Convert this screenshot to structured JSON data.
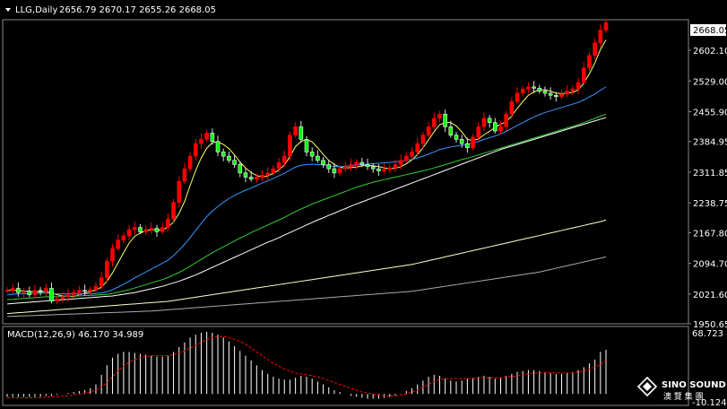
{
  "header": {
    "symbol_label": "LLG,Daily",
    "ohlc": "2656.79 2670.17 2655.26 2668.05"
  },
  "macd_header": "MACD(12,26,9) 46.170 34.989",
  "price_axis": {
    "ticks": [
      "2602.10",
      "2529.00",
      "2455.90",
      "2384.95",
      "2311.85",
      "2238.75",
      "2167.80",
      "2094.70",
      "2021.60",
      "1950.65"
    ],
    "current_label": "2668.05"
  },
  "macd_axis": {
    "top_label": "68.723",
    "bottom_label": "-10.124"
  },
  "watermark": {
    "brand": "SINO SOUND",
    "cjk": "澳 覽 集 團"
  },
  "colors": {
    "background": "#000000",
    "bull_candle": "#ffffff",
    "bear_candle": "#ff0000",
    "up_candle_fill": "#00ff00",
    "ma5": "#ffff66",
    "ma20": "#3399ff",
    "ma40": "#33cc33",
    "ma60": "#ffffff",
    "ma120": "#ffffcc",
    "ma250": "#aaaaaa",
    "macd_hist": "#ffffff",
    "macd_signal": "#ff0000"
  },
  "chart_data": {
    "type": "candlestick",
    "title": "LLG,Daily",
    "ylim": [
      1950.65,
      2675
    ],
    "y_ticks": [
      1950.65,
      2021.6,
      2094.7,
      2167.8,
      2238.75,
      2311.85,
      2384.95,
      2455.9,
      2529.0,
      2602.1
    ],
    "current_close": 2668.05,
    "closes": [
      2030,
      2035,
      2025,
      2028,
      2020,
      2030,
      2028,
      2035,
      2005,
      2010,
      2015,
      2020,
      2025,
      2030,
      2028,
      2032,
      2040,
      2060,
      2100,
      2130,
      2150,
      2160,
      2175,
      2180,
      2170,
      2175,
      2178,
      2170,
      2180,
      2200,
      2240,
      2290,
      2320,
      2350,
      2380,
      2390,
      2405,
      2385,
      2360,
      2350,
      2340,
      2330,
      2310,
      2300,
      2295,
      2300,
      2305,
      2310,
      2320,
      2335,
      2350,
      2400,
      2420,
      2390,
      2360,
      2350,
      2340,
      2330,
      2320,
      2310,
      2320,
      2325,
      2330,
      2335,
      2330,
      2325,
      2320,
      2315,
      2318,
      2322,
      2330,
      2340,
      2350,
      2360,
      2380,
      2400,
      2420,
      2440,
      2450,
      2420,
      2400,
      2390,
      2380,
      2370,
      2395,
      2420,
      2440,
      2430,
      2410,
      2420,
      2450,
      2480,
      2500,
      2510,
      2515,
      2512,
      2505,
      2500,
      2495,
      2492,
      2498,
      2505,
      2510,
      2525,
      2560,
      2590,
      2620,
      2650,
      2668.05
    ],
    "series": [
      {
        "name": "MA5",
        "values": [
          2030,
          2031,
          2030,
          2029,
          2028,
          2027,
          2026,
          2028,
          2024,
          2020,
          2017,
          2016,
          2015,
          2020,
          2024,
          2027,
          2031,
          2038,
          2052,
          2072,
          2096,
          2120,
          2143,
          2159,
          2167,
          2172,
          2175,
          2174,
          2174,
          2181,
          2193,
          2214,
          2242,
          2280,
          2316,
          2346,
          2369,
          2382,
          2384,
          2378,
          2368,
          2353,
          2336,
          2322,
          2311,
          2304,
          2300,
          2303,
          2309,
          2317,
          2329,
          2349,
          2373,
          2385,
          2390,
          2384,
          2370,
          2354,
          2340,
          2330,
          2324,
          2321,
          2323,
          2324,
          2327,
          2328,
          2327,
          2325,
          2322,
          2320,
          2321,
          2325,
          2332,
          2341,
          2354,
          2370,
          2389,
          2408,
          2425,
          2430,
          2430,
          2422,
          2408,
          2390,
          2387,
          2391,
          2401,
          2409,
          2419,
          2426,
          2432,
          2446,
          2464,
          2480,
          2495,
          2503,
          2508,
          2508,
          2505,
          2500,
          2499,
          2500,
          2502,
          2508,
          2524,
          2546,
          2572,
          2604,
          2627
        ]
      },
      {
        "name": "MA20",
        "values": [
          2020,
          2021,
          2022,
          2022,
          2023,
          2023,
          2023,
          2024,
          2023,
          2022,
          2022,
          2022,
          2022,
          2022,
          2022,
          2022,
          2023,
          2024,
          2027,
          2032,
          2038,
          2045,
          2052,
          2060,
          2067,
          2074,
          2081,
          2088,
          2095,
          2102,
          2113,
          2126,
          2140,
          2156,
          2173,
          2190,
          2206,
          2219,
          2230,
          2240,
          2249,
          2256,
          2263,
          2269,
          2274,
          2280,
          2286,
          2291,
          2297,
          2303,
          2309,
          2317,
          2324,
          2328,
          2330,
          2331,
          2330,
          2329,
          2327,
          2325,
          2325,
          2326,
          2327,
          2329,
          2330,
          2331,
          2332,
          2333,
          2334,
          2335,
          2336,
          2338,
          2340,
          2342,
          2346,
          2350,
          2355,
          2360,
          2366,
          2369,
          2372,
          2374,
          2376,
          2378,
          2381,
          2385,
          2390,
          2394,
          2398,
          2403,
          2409,
          2416,
          2423,
          2430,
          2437,
          2443,
          2449,
          2454,
          2458,
          2462,
          2466,
          2470,
          2474,
          2478,
          2484,
          2491,
          2498,
          2507,
          2515
        ]
      },
      {
        "name": "MA40",
        "values": [
          2008,
          2009,
          2010,
          2011,
          2012,
          2013,
          2014,
          2015,
          2015,
          2015,
          2016,
          2016,
          2017,
          2017,
          2018,
          2018,
          2019,
          2020,
          2021,
          2023,
          2026,
          2029,
          2032,
          2036,
          2040,
          2044,
          2048,
          2052,
          2056,
          2061,
          2067,
          2073,
          2080,
          2088,
          2096,
          2104,
          2112,
          2120,
          2127,
          2134,
          2141,
          2148,
          2155,
          2161,
          2168,
          2174,
          2180,
          2186,
          2192,
          2198,
          2204,
          2211,
          2218,
          2224,
          2230,
          2236,
          2241,
          2246,
          2251,
          2256,
          2261,
          2266,
          2271,
          2276,
          2280,
          2284,
          2288,
          2291,
          2294,
          2297,
          2300,
          2303,
          2306,
          2309,
          2312,
          2315,
          2318,
          2322,
          2326,
          2330,
          2334,
          2338,
          2342,
          2345,
          2349,
          2353,
          2357,
          2361,
          2365,
          2369,
          2373,
          2377,
          2381,
          2385,
          2389,
          2393,
          2397,
          2401,
          2405,
          2409,
          2413,
          2417,
          2421,
          2425,
          2430,
          2435,
          2440,
          2445,
          2450
        ]
      },
      {
        "name": "MA60",
        "values": [
          1998,
          1999,
          2000,
          2001,
          2002,
          2003,
          2004,
          2005,
          2006,
          2007,
          2008,
          2009,
          2010,
          2011,
          2012,
          2013,
          2014,
          2015,
          2016,
          2017,
          2019,
          2021,
          2023,
          2025,
          2028,
          2031,
          2034,
          2037,
          2040,
          2044,
          2048,
          2052,
          2057,
          2062,
          2067,
          2073,
          2079,
          2085,
          2091,
          2097,
          2103,
          2109,
          2115,
          2121,
          2127,
          2133,
          2139,
          2145,
          2150,
          2156,
          2162,
          2168,
          2174,
          2180,
          2186,
          2192,
          2198,
          2203,
          2209,
          2214,
          2220,
          2225,
          2231,
          2236,
          2241,
          2246,
          2251,
          2256,
          2261,
          2266,
          2271,
          2276,
          2281,
          2286,
          2291,
          2296,
          2301,
          2306,
          2311,
          2316,
          2321,
          2326,
          2331,
          2336,
          2341,
          2346,
          2351,
          2356,
          2361,
          2366,
          2370,
          2374,
          2378,
          2382,
          2386,
          2390,
          2394,
          2398,
          2402,
          2406,
          2410,
          2414,
          2418,
          2422,
          2426,
          2430,
          2434,
          2438,
          2442
        ]
      },
      {
        "name": "MA120",
        "values": [
          1975,
          1976,
          1977,
          1978,
          1979,
          1980,
          1981,
          1982,
          1983,
          1984,
          1985,
          1986,
          1987,
          1988,
          1989,
          1990,
          1991,
          1992,
          1993,
          1994,
          1995,
          1996,
          1997,
          1998,
          1999,
          2000,
          2001,
          2002,
          2003,
          2004,
          2006,
          2008,
          2010,
          2012,
          2014,
          2016,
          2018,
          2020,
          2022,
          2024,
          2026,
          2028,
          2030,
          2032,
          2034,
          2036,
          2038,
          2040,
          2042,
          2044,
          2046,
          2048,
          2050,
          2052,
          2054,
          2056,
          2058,
          2060,
          2062,
          2064,
          2066,
          2068,
          2070,
          2072,
          2074,
          2076,
          2078,
          2080,
          2082,
          2084,
          2086,
          2088,
          2090,
          2092,
          2095,
          2098,
          2101,
          2104,
          2107,
          2110,
          2113,
          2116,
          2119,
          2122,
          2125,
          2128,
          2131,
          2134,
          2137,
          2140,
          2143,
          2146,
          2149,
          2152,
          2155,
          2158,
          2161,
          2164,
          2167,
          2170,
          2173,
          2176,
          2179,
          2182,
          2185,
          2188,
          2191,
          2194,
          2198
        ]
      },
      {
        "name": "MA250",
        "values": [
          1968,
          1968.5,
          1969,
          1969.5,
          1970,
          1970.5,
          1971,
          1971.5,
          1972,
          1972.5,
          1973,
          1973.5,
          1974,
          1974.5,
          1975,
          1975.5,
          1976,
          1976.5,
          1977,
          1977.5,
          1978,
          1978.5,
          1979,
          1979.5,
          1980,
          1980.5,
          1981,
          1982,
          1983,
          1984,
          1985,
          1986,
          1987,
          1988,
          1989,
          1990,
          1991,
          1992,
          1993,
          1994,
          1995,
          1996,
          1997,
          1998,
          1999,
          2000,
          2001,
          2002,
          2003,
          2004,
          2005,
          2006,
          2007,
          2008,
          2009,
          2010,
          2011,
          2012,
          2013,
          2014,
          2015,
          2016,
          2017,
          2018,
          2019,
          2020,
          2021,
          2022,
          2023,
          2024,
          2025,
          2026,
          2027,
          2028,
          2030,
          2032,
          2034,
          2036,
          2038,
          2040,
          2042,
          2044,
          2046,
          2048,
          2050,
          2052,
          2054,
          2056,
          2058,
          2060,
          2062,
          2064,
          2066,
          2068,
          2070,
          2072,
          2074,
          2077,
          2080,
          2083,
          2086,
          2089,
          2092,
          2095,
          2098,
          2101,
          2104,
          2107,
          2110
        ]
      }
    ],
    "macd": {
      "name": "MACD(12,26,9)",
      "main": 46.17,
      "signal_value": 34.989,
      "ylim": [
        -10.124,
        68.723
      ],
      "histogram": [
        -3,
        -3,
        -3,
        -3,
        -3,
        -3,
        -3,
        -2,
        -2,
        -1,
        0,
        1,
        2,
        3,
        4,
        6,
        10,
        20,
        30,
        38,
        42,
        44,
        44,
        43,
        42,
        41,
        40,
        39,
        39,
        40,
        44,
        49,
        54,
        59,
        62,
        64,
        65,
        64,
        62,
        59,
        55,
        50,
        45,
        40,
        35,
        30,
        25,
        21,
        18,
        16,
        15,
        15,
        17,
        19,
        18,
        16,
        13,
        10,
        7,
        4,
        2,
        0,
        -2,
        -3,
        -4,
        -5,
        -5,
        -5,
        -4,
        -3,
        -2,
        0,
        3,
        6,
        10,
        14,
        18,
        20,
        19,
        16,
        14,
        13,
        14,
        16,
        17,
        18,
        19,
        18,
        16,
        17,
        19,
        21,
        23,
        24,
        25,
        25,
        24,
        23,
        22,
        21,
        21,
        22,
        23,
        25,
        28,
        32,
        36,
        44,
        46.17
      ],
      "signal": [
        -4,
        -4,
        -4,
        -4,
        -4,
        -4,
        -4,
        -3,
        -3,
        -3,
        -2,
        -2,
        -1,
        0,
        1,
        2,
        4,
        7,
        12,
        18,
        24,
        29,
        33,
        36,
        38,
        39,
        40,
        40,
        40,
        40,
        41,
        43,
        45,
        48,
        51,
        54,
        57,
        59,
        60,
        60,
        59,
        57,
        55,
        52,
        48,
        44,
        40,
        36,
        32,
        29,
        26,
        24,
        22,
        21,
        20,
        19,
        18,
        16,
        14,
        12,
        10,
        8,
        6,
        4,
        2,
        1,
        0,
        -1,
        -2,
        -2,
        -2,
        -1,
        0,
        2,
        4,
        7,
        10,
        13,
        15,
        16,
        16,
        16,
        16,
        16,
        16,
        17,
        17,
        17,
        17,
        17,
        18,
        18,
        19,
        20,
        21,
        22,
        22,
        22,
        22,
        22,
        22,
        22,
        22,
        23,
        24,
        26,
        28,
        31,
        34.989
      ]
    }
  }
}
